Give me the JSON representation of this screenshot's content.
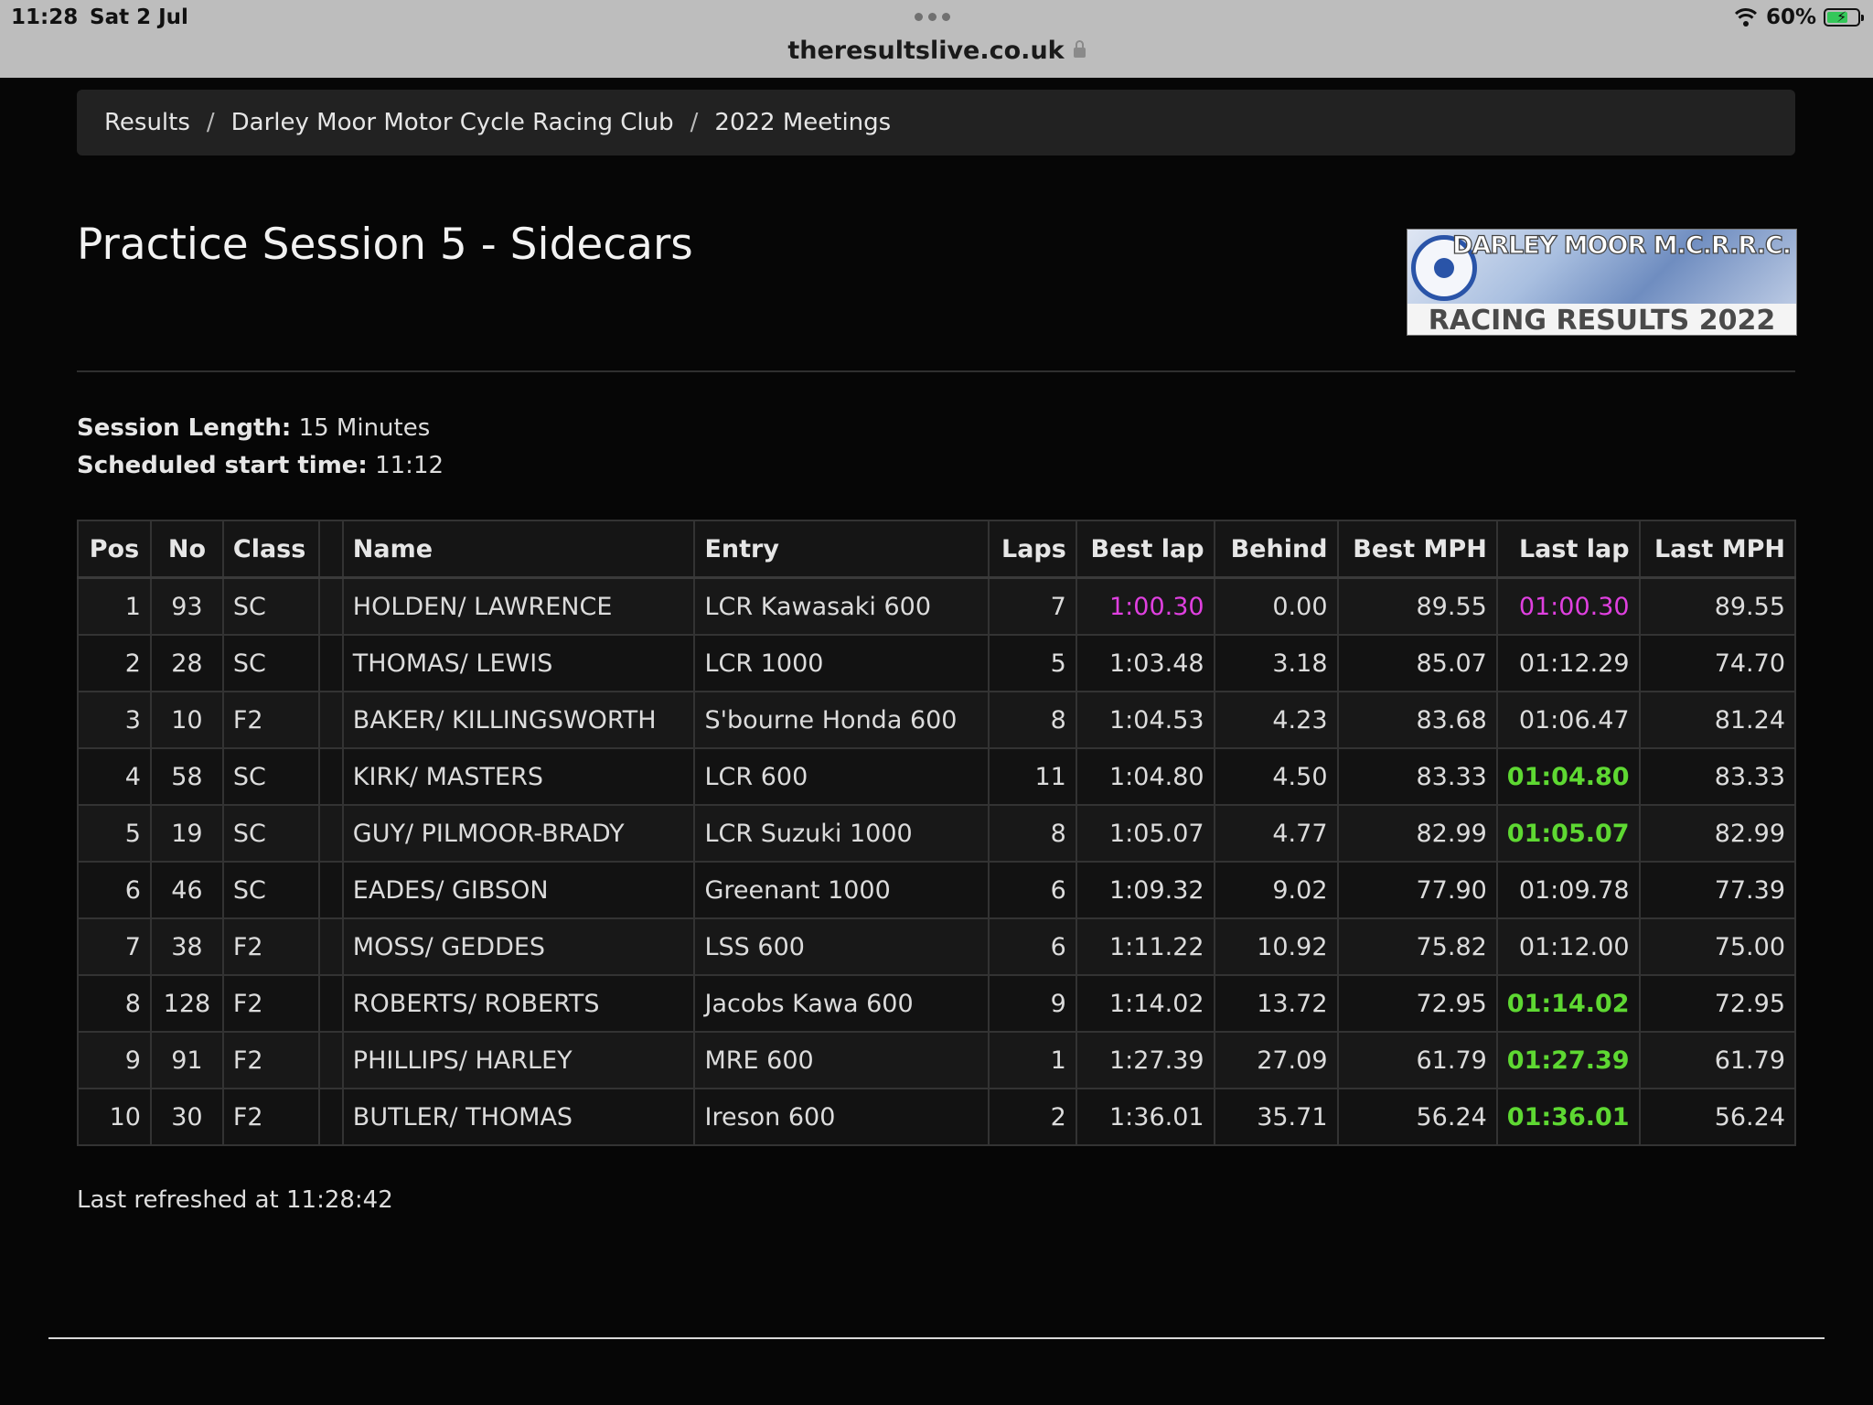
{
  "status_bar": {
    "time": "11:28",
    "date": "Sat 2 Jul",
    "url": "theresultslive.co.uk",
    "battery": "60%"
  },
  "breadcrumb": [
    "Results",
    "Darley Moor Motor Cycle Racing Club",
    "2022 Meetings"
  ],
  "page_title": "Practice Session 5 - Sidecars",
  "logo": {
    "top_text": "DARLEY MOOR M.C.R.R.C.",
    "bottom_text": "RACING RESULTS 2022"
  },
  "session": {
    "length_label": "Session Length:",
    "length_value": "15 Minutes",
    "start_label": "Scheduled start time:",
    "start_value": "11:12"
  },
  "table": {
    "headers": [
      "Pos",
      "No",
      "Class",
      "",
      "Name",
      "Entry",
      "Laps",
      "Best lap",
      "Behind",
      "Best MPH",
      "Last lap",
      "Last MPH"
    ],
    "rows": [
      {
        "pos": "1",
        "no": "93",
        "class": "SC",
        "name": "HOLDEN/ LAWRENCE",
        "entry": "LCR Kawasaki 600",
        "laps": "7",
        "best_lap": "1:00.30",
        "behind": "0.00",
        "best_mph": "89.55",
        "last_lap": "01:00.30",
        "last_mph": "89.55",
        "best_color": "magenta",
        "last_color": "magenta"
      },
      {
        "pos": "2",
        "no": "28",
        "class": "SC",
        "name": "THOMAS/ LEWIS",
        "entry": "LCR 1000",
        "laps": "5",
        "best_lap": "1:03.48",
        "behind": "3.18",
        "best_mph": "85.07",
        "last_lap": "01:12.29",
        "last_mph": "74.70",
        "best_color": "",
        "last_color": ""
      },
      {
        "pos": "3",
        "no": "10",
        "class": "F2",
        "name": "BAKER/ KILLINGSWORTH",
        "entry": "S'bourne Honda 600",
        "laps": "8",
        "best_lap": "1:04.53",
        "behind": "4.23",
        "best_mph": "83.68",
        "last_lap": "01:06.47",
        "last_mph": "81.24",
        "best_color": "",
        "last_color": ""
      },
      {
        "pos": "4",
        "no": "58",
        "class": "SC",
        "name": "KIRK/ MASTERS",
        "entry": "LCR 600",
        "laps": "11",
        "best_lap": "1:04.80",
        "behind": "4.50",
        "best_mph": "83.33",
        "last_lap": "01:04.80",
        "last_mph": "83.33",
        "best_color": "",
        "last_color": "green"
      },
      {
        "pos": "5",
        "no": "19",
        "class": "SC",
        "name": "GUY/ PILMOOR-BRADY",
        "entry": "LCR Suzuki 1000",
        "laps": "8",
        "best_lap": "1:05.07",
        "behind": "4.77",
        "best_mph": "82.99",
        "last_lap": "01:05.07",
        "last_mph": "82.99",
        "best_color": "",
        "last_color": "green"
      },
      {
        "pos": "6",
        "no": "46",
        "class": "SC",
        "name": "EADES/ GIBSON",
        "entry": "Greenant 1000",
        "laps": "6",
        "best_lap": "1:09.32",
        "behind": "9.02",
        "best_mph": "77.90",
        "last_lap": "01:09.78",
        "last_mph": "77.39",
        "best_color": "",
        "last_color": ""
      },
      {
        "pos": "7",
        "no": "38",
        "class": "F2",
        "name": "MOSS/ GEDDES",
        "entry": "LSS 600",
        "laps": "6",
        "best_lap": "1:11.22",
        "behind": "10.92",
        "best_mph": "75.82",
        "last_lap": "01:12.00",
        "last_mph": "75.00",
        "best_color": "",
        "last_color": ""
      },
      {
        "pos": "8",
        "no": "128",
        "class": "F2",
        "name": "ROBERTS/ ROBERTS",
        "entry": "Jacobs Kawa 600",
        "laps": "9",
        "best_lap": "1:14.02",
        "behind": "13.72",
        "best_mph": "72.95",
        "last_lap": "01:14.02",
        "last_mph": "72.95",
        "best_color": "",
        "last_color": "green"
      },
      {
        "pos": "9",
        "no": "91",
        "class": "F2",
        "name": "PHILLIPS/ HARLEY",
        "entry": "MRE 600",
        "laps": "1",
        "best_lap": "1:27.39",
        "behind": "27.09",
        "best_mph": "61.79",
        "last_lap": "01:27.39",
        "last_mph": "61.79",
        "best_color": "",
        "last_color": "green"
      },
      {
        "pos": "10",
        "no": "30",
        "class": "F2",
        "name": "BUTLER/ THOMAS",
        "entry": "Ireson 600",
        "laps": "2",
        "best_lap": "1:36.01",
        "behind": "35.71",
        "best_mph": "56.24",
        "last_lap": "01:36.01",
        "last_mph": "56.24",
        "best_color": "",
        "last_color": "green"
      }
    ]
  },
  "footer": {
    "last_refreshed": "Last refreshed at 11:28:42"
  },
  "colors": {
    "personal_best": "#e040e0",
    "improved": "#5ed832",
    "background": "#060606"
  }
}
